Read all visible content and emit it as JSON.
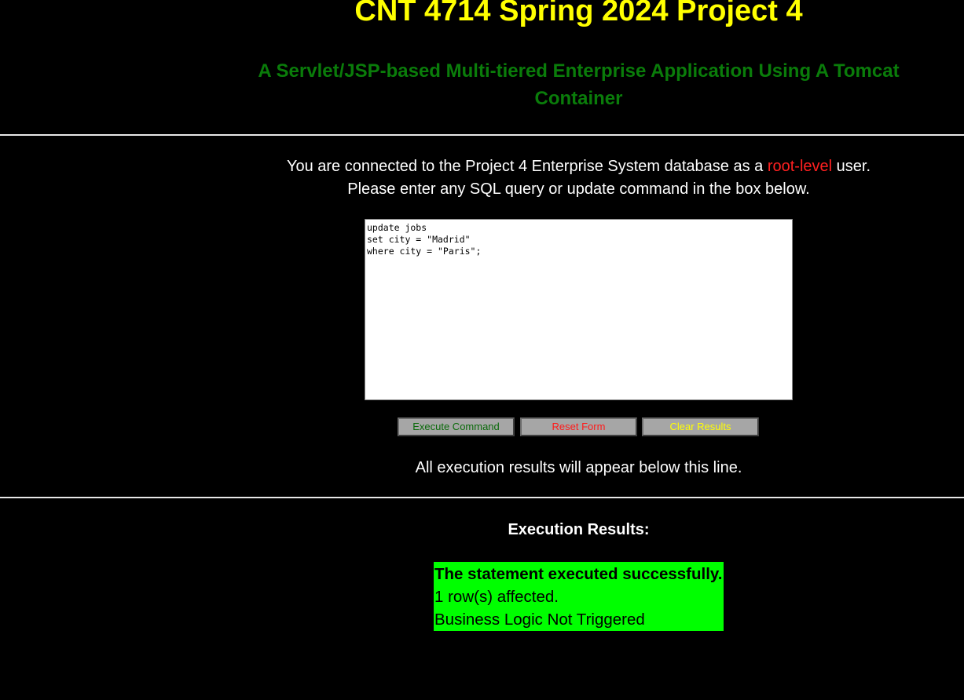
{
  "header": {
    "title": "CNT 4714 Spring 2024 Project 4",
    "subtitle": "A Servlet/JSP-based Multi-tiered Enterprise Application Using A Tomcat Container"
  },
  "intro": {
    "prefix": "You are connected to the Project 4 Enterprise System database as a ",
    "role": "root-level",
    "suffix": " user.",
    "line2": "Please enter any SQL query or update command in the box below."
  },
  "query": {
    "value": "update jobs\nset city = \"Madrid\"\nwhere city = \"Paris\";"
  },
  "buttons": {
    "execute_label": "Execute Command",
    "reset_label": "Reset Form",
    "clear_label": "Clear Results"
  },
  "note": "All execution results will appear below this line.",
  "results": {
    "heading": "Execution Results:",
    "status": "The statement executed successfully.",
    "rows_affected": "1 row(s) affected.",
    "business_logic": "Business Logic Not Triggered"
  },
  "colors": {
    "background": "#000000",
    "title": "#ffff00",
    "subtitle": "#0a7c0a",
    "role_accent": "#ff2020",
    "result_background": "#00ff00",
    "button_background": "#a6a6a6"
  }
}
